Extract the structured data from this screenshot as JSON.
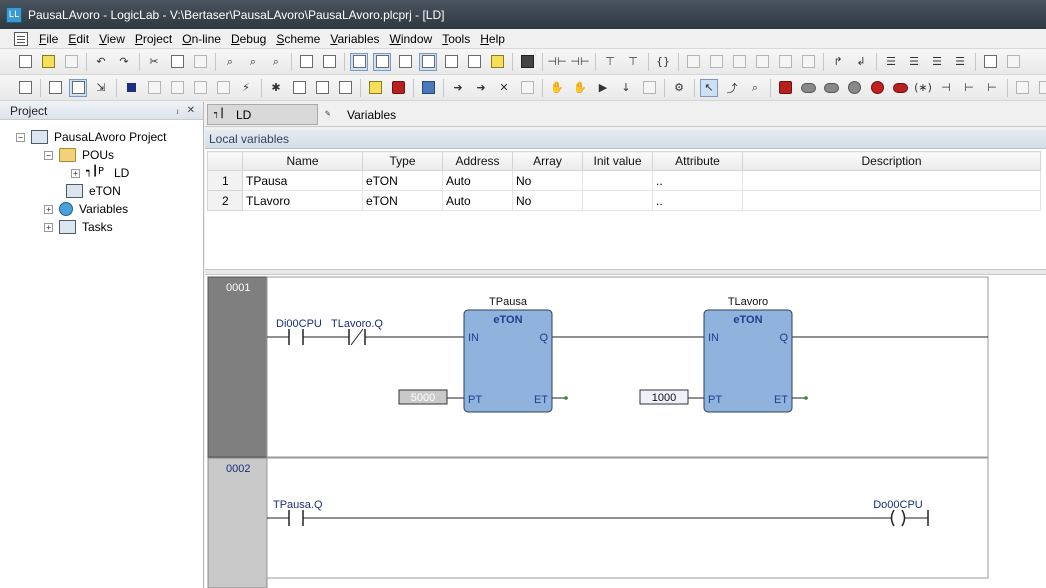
{
  "window": {
    "title": "PausaLAvoro - LogicLab - V:\\Bertaser\\PausaLAvoro\\PausaLAvoro.plcprj - [LD]",
    "app_icon_text": "LL"
  },
  "menu": {
    "items": [
      {
        "key": "F",
        "rest": "ile"
      },
      {
        "key": "E",
        "rest": "dit"
      },
      {
        "key": "V",
        "rest": "iew"
      },
      {
        "key": "P",
        "rest": "roject"
      },
      {
        "key": "O",
        "rest": "n-line"
      },
      {
        "key": "D",
        "rest": "ebug"
      },
      {
        "key": "S",
        "rest": "cheme"
      },
      {
        "key": "V",
        "rest": "ariables"
      },
      {
        "key": "W",
        "rest": "indow"
      },
      {
        "key": "T",
        "rest": "ools"
      },
      {
        "key": "H",
        "rest": "elp"
      }
    ]
  },
  "project_panel": {
    "title": "Project",
    "pin_glyph": "ⱼ",
    "close_glyph": "✕",
    "tree": {
      "root": "PausaLAvoro Project",
      "pous": "POUs",
      "ld": "LD",
      "ld_icon_text": "┑┃P",
      "eton": "eTON",
      "variables": "Variables",
      "tasks": "Tasks",
      "expand_minus": "−",
      "expand_plus": "+"
    }
  },
  "editor_tabs": {
    "ld": "LD",
    "variables": "Variables",
    "ld_icon_text": "┑┃",
    "variables_icon_text": "✎"
  },
  "local_variables": {
    "title": "Local variables",
    "columns": [
      "",
      "Name",
      "Type",
      "Address",
      "Array",
      "Init value",
      "Attribute",
      "Description"
    ],
    "rows": [
      {
        "num": "1",
        "name": "TPausa",
        "type": "eTON",
        "address": "Auto",
        "array": "No",
        "init": "",
        "attribute": "..",
        "description": ""
      },
      {
        "num": "2",
        "name": "TLavoro",
        "type": "eTON",
        "address": "Auto",
        "array": "No",
        "init": "",
        "attribute": "..",
        "description": ""
      }
    ]
  },
  "ladder": {
    "networks": [
      {
        "number": "0001",
        "contacts": [
          {
            "label": "Di00CPU",
            "kind": "NO"
          },
          {
            "label": "TLavoro.Q",
            "kind": "NC"
          }
        ],
        "blocks": [
          {
            "instance": "TPausa",
            "type": "eTON",
            "in": "IN",
            "q": "Q",
            "pt": "PT",
            "et": "ET",
            "pt_value": "5000"
          },
          {
            "instance": "TLavoro",
            "type": "eTON",
            "in": "IN",
            "q": "Q",
            "pt": "PT",
            "et": "ET",
            "pt_value": "1000"
          }
        ]
      },
      {
        "number": "0002",
        "contacts": [
          {
            "label": "TPausa.Q",
            "kind": "NO"
          }
        ],
        "coil": {
          "label": "Do00CPU"
        }
      }
    ]
  },
  "colors": {
    "block_fill": "#8fb3dd",
    "block_border": "#2b3f5a",
    "block_type_text": "#1f3f8f",
    "network_label_active": "#7f7f7f",
    "network_label_inactive": "#c9c9c9",
    "wire": "#222222",
    "et_pin": "#2e8b2e"
  }
}
